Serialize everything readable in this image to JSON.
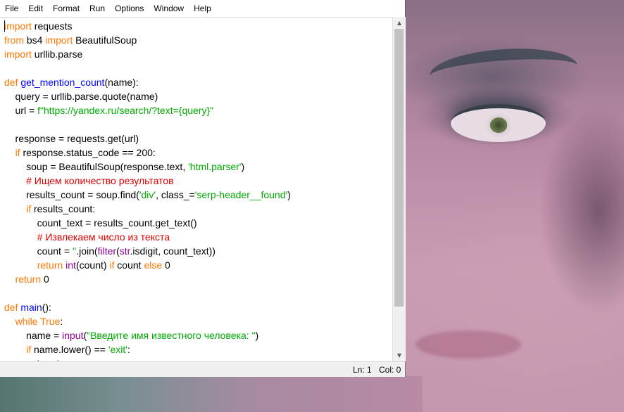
{
  "menu": [
    "File",
    "Edit",
    "Format",
    "Run",
    "Options",
    "Window",
    "Help"
  ],
  "colors": {
    "keyword": "#ff7700",
    "definition": "#0000ff",
    "builtin": "#900090",
    "string": "#00aa00",
    "comment": "#dd0000",
    "default": "#000000"
  },
  "code_lines": [
    [
      [
        "import",
        "kw"
      ],
      [
        " requests",
        ""
      ]
    ],
    [
      [
        "from",
        "kw"
      ],
      [
        " bs4 ",
        ""
      ],
      [
        "import",
        "kw"
      ],
      [
        " BeautifulSoup",
        ""
      ]
    ],
    [
      [
        "import",
        "kw"
      ],
      [
        " urllib.parse",
        ""
      ]
    ],
    [],
    [
      [
        "def",
        "kw"
      ],
      [
        " ",
        ""
      ],
      [
        "get_mention_count",
        "fn"
      ],
      [
        "(name):",
        ""
      ]
    ],
    [
      [
        "    query = urllib.parse.quote(name)",
        ""
      ]
    ],
    [
      [
        "    url = ",
        ""
      ],
      [
        "f\"https://yandex.ru/search/?text={query}\"",
        "str"
      ]
    ],
    [],
    [
      [
        "    response = requests.get(url)",
        ""
      ]
    ],
    [
      [
        "    ",
        ""
      ],
      [
        "if",
        "kw"
      ],
      [
        " response.status_code == 200:",
        ""
      ]
    ],
    [
      [
        "        soup = BeautifulSoup(response.text, ",
        ""
      ],
      [
        "'html.parser'",
        "str"
      ],
      [
        ")",
        ""
      ]
    ],
    [
      [
        "        ",
        ""
      ],
      [
        "# Ищем количество результатов",
        "cm"
      ]
    ],
    [
      [
        "        results_count = soup.find(",
        ""
      ],
      [
        "'div'",
        "str"
      ],
      [
        ", class_=",
        ""
      ],
      [
        "'serp-header__found'",
        "str"
      ],
      [
        ")",
        ""
      ]
    ],
    [
      [
        "        ",
        ""
      ],
      [
        "if",
        "kw"
      ],
      [
        " results_count:",
        ""
      ]
    ],
    [
      [
        "            count_text = results_count.get_text()",
        ""
      ]
    ],
    [
      [
        "            ",
        ""
      ],
      [
        "# Извлекаем число из текста",
        "cm"
      ]
    ],
    [
      [
        "            count = ",
        ""
      ],
      [
        "''",
        "str"
      ],
      [
        ".join(",
        ""
      ],
      [
        "filter",
        "bi"
      ],
      [
        "(",
        ""
      ],
      [
        "str",
        "bi"
      ],
      [
        ".isdigit, count_text))",
        ""
      ]
    ],
    [
      [
        "            ",
        ""
      ],
      [
        "return",
        "kw"
      ],
      [
        " ",
        ""
      ],
      [
        "int",
        "bi"
      ],
      [
        "(count) ",
        ""
      ],
      [
        "if",
        "kw"
      ],
      [
        " count ",
        ""
      ],
      [
        "else",
        "kw"
      ],
      [
        " 0",
        ""
      ]
    ],
    [
      [
        "    ",
        ""
      ],
      [
        "return",
        "kw"
      ],
      [
        " 0",
        ""
      ]
    ],
    [],
    [
      [
        "def",
        "kw"
      ],
      [
        " ",
        ""
      ],
      [
        "main",
        "fn"
      ],
      [
        "():",
        ""
      ]
    ],
    [
      [
        "    ",
        ""
      ],
      [
        "while",
        "kw"
      ],
      [
        " ",
        ""
      ],
      [
        "True",
        "kw"
      ],
      [
        ":",
        ""
      ]
    ],
    [
      [
        "        name = ",
        ""
      ],
      [
        "input",
        "bi"
      ],
      [
        "(",
        ""
      ],
      [
        "\"Введите имя известного человека: \"",
        "str"
      ],
      [
        ")",
        ""
      ]
    ],
    [
      [
        "        ",
        ""
      ],
      [
        "if",
        "kw"
      ],
      [
        " name.lower() == ",
        ""
      ],
      [
        "'exit'",
        "str"
      ],
      [
        ":",
        ""
      ]
    ],
    [
      [
        "            ",
        ""
      ],
      [
        "break",
        "kw"
      ]
    ]
  ],
  "status": {
    "line": "Ln: 1",
    "col": "Col: 0"
  }
}
